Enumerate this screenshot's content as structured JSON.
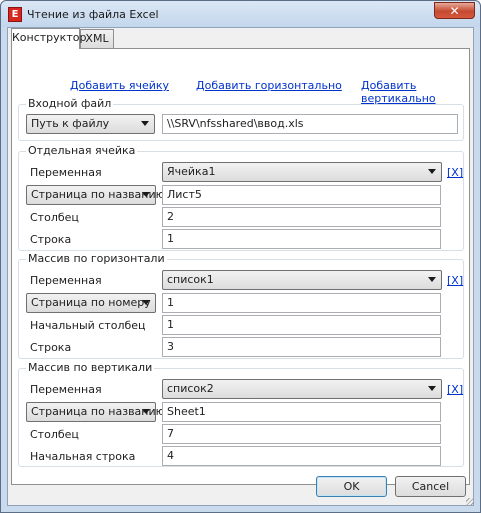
{
  "window": {
    "title": "Чтение из файла Excel",
    "close_glyph": "✕",
    "app_icon_glyph": "E"
  },
  "tabs": [
    {
      "label": "Конструктор"
    },
    {
      "label": "XML"
    }
  ],
  "links": {
    "add_cell": "Добавить ячейку",
    "add_horizontal": "Добавить горизонтально",
    "add_vertical": "Добавить вертикально"
  },
  "input_file": {
    "title": "Входной файл",
    "mode": "Путь к файлу",
    "path": "\\\\SRV\\nfsshared\\ввод.xls"
  },
  "single_cell": {
    "title": "Отдельная ячейка",
    "variable_label": "Переменная",
    "variable_value": "Ячейка1",
    "remove": "[X]",
    "sheet_mode": "Страница по названию",
    "sheet_value": "Лист5",
    "column_label": "Столбец",
    "column_value": "2",
    "row_label": "Строка",
    "row_value": "1"
  },
  "horizontal_array": {
    "title": "Массив по горизонтали",
    "variable_label": "Переменная",
    "variable_value": "список1",
    "remove": "[X]",
    "sheet_mode": "Страница по номеру",
    "sheet_value": "1",
    "start_column_label": "Начальный столбец",
    "start_column_value": "1",
    "row_label": "Строка",
    "row_value": "3"
  },
  "vertical_array": {
    "title": "Массив по вертикали",
    "variable_label": "Переменная",
    "variable_value": "список2",
    "remove": "[X]",
    "sheet_mode": "Страница по названию",
    "sheet_value": "Sheet1",
    "column_label": "Столбец",
    "column_value": "7",
    "start_row_label": "Начальная строка",
    "start_row_value": "4"
  },
  "buttons": {
    "ok": "OK",
    "cancel": "Cancel"
  }
}
